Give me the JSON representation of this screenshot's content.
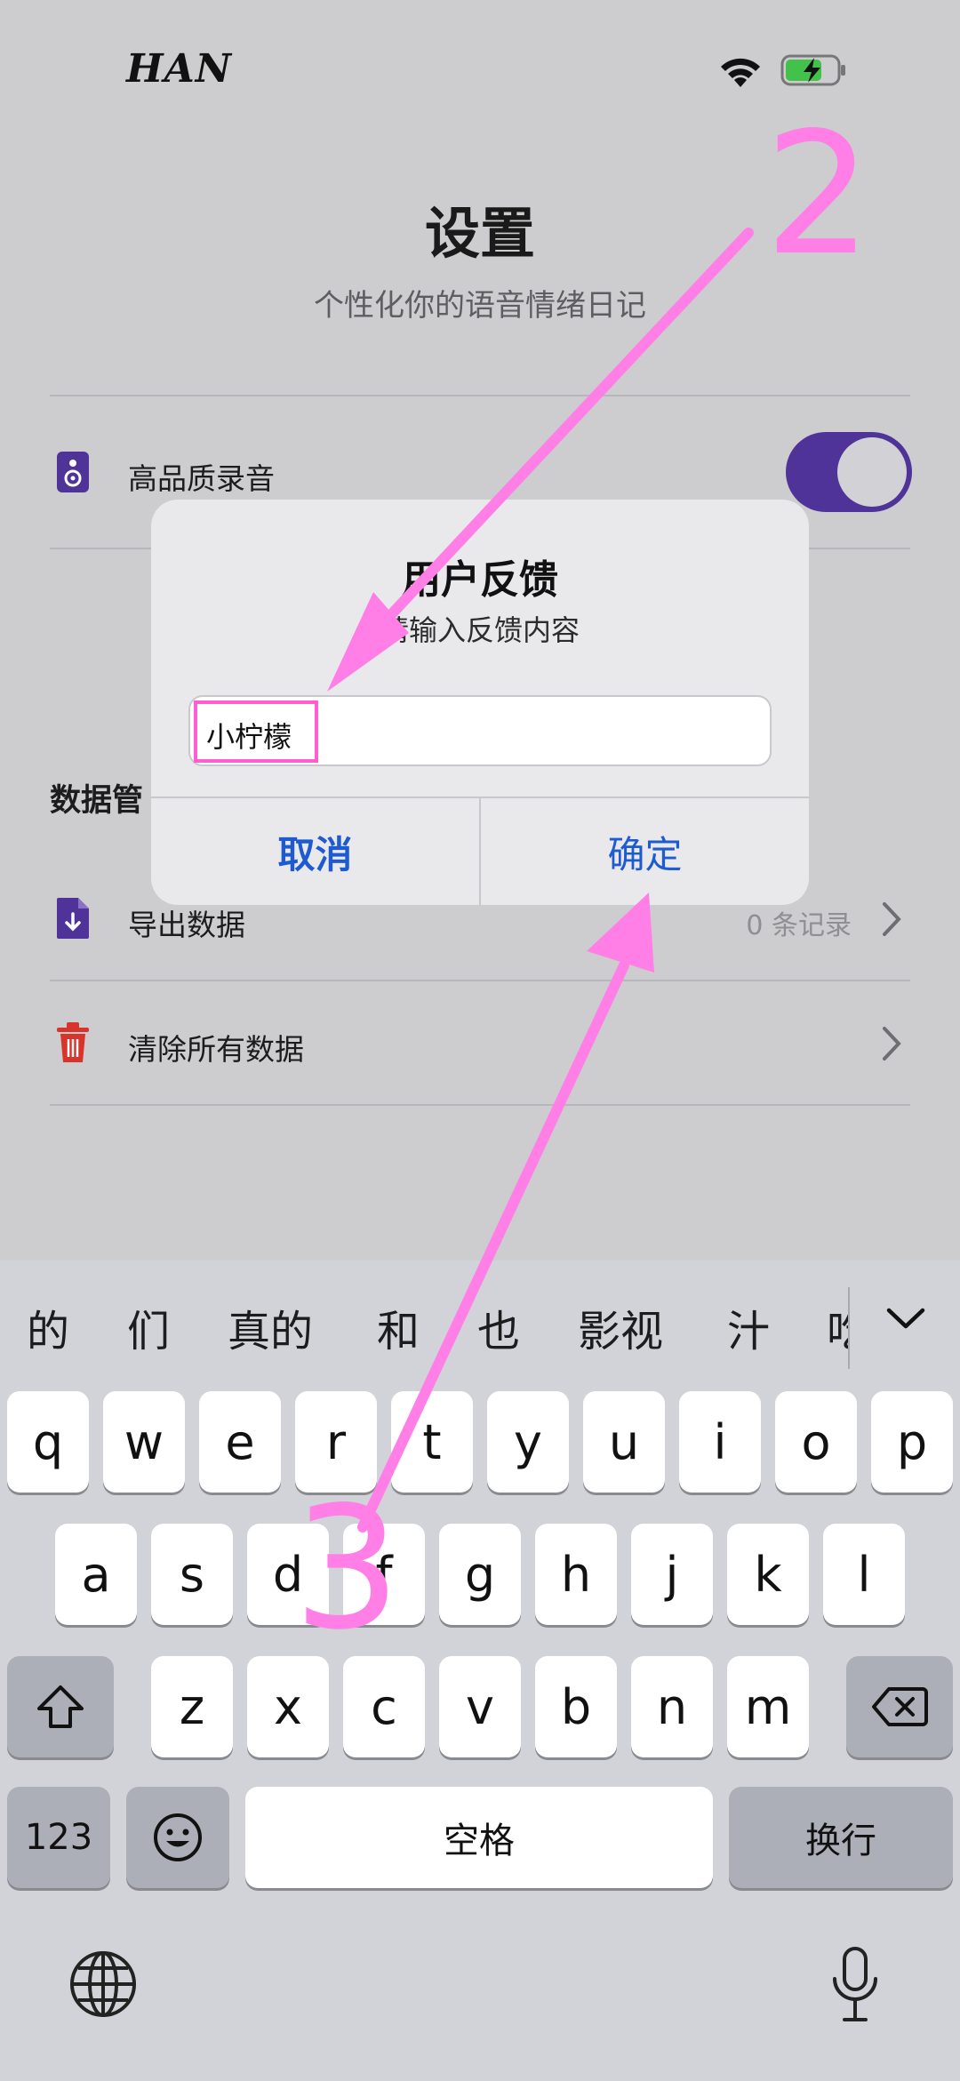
{
  "status_bar": {
    "carrier": "HAN",
    "icons": [
      "wifi-icon",
      "battery-charging-icon"
    ]
  },
  "header": {
    "title": "设置",
    "subtitle": "个性化你的语音情绪日记"
  },
  "settings": {
    "high_quality_recording": {
      "label": "高品质录音",
      "icon": "speaker-icon",
      "enabled": true
    },
    "data_section_title": "数据管",
    "export": {
      "label": "导出数据",
      "value": "0 条记录",
      "icon": "export-file-icon"
    },
    "clear": {
      "label": "清除所有数据",
      "icon": "trash-icon"
    }
  },
  "alert": {
    "title": "用户反馈",
    "message": "请输入反馈内容",
    "input_value": "小柠檬",
    "cancel_label": "取消",
    "confirm_label": "确定"
  },
  "keyboard": {
    "candidates": [
      "的",
      "们",
      "真的",
      "和",
      "也",
      "影视",
      "汁",
      "吃"
    ],
    "row1": [
      "q",
      "w",
      "e",
      "r",
      "t",
      "y",
      "u",
      "i",
      "o",
      "p"
    ],
    "row2": [
      "a",
      "s",
      "d",
      "f",
      "g",
      "h",
      "j",
      "k",
      "l"
    ],
    "row3": [
      "z",
      "x",
      "c",
      "v",
      "b",
      "n",
      "m"
    ],
    "numbers_label": "123",
    "space_label": "空格",
    "return_label": "换行"
  },
  "annotations": {
    "step_2": "2",
    "step_3": "3",
    "color": "#ff7fe6"
  },
  "colors": {
    "accent_purple": "#4f3399",
    "link_blue": "#1e5bd0",
    "trash_red": "#d9342b"
  }
}
